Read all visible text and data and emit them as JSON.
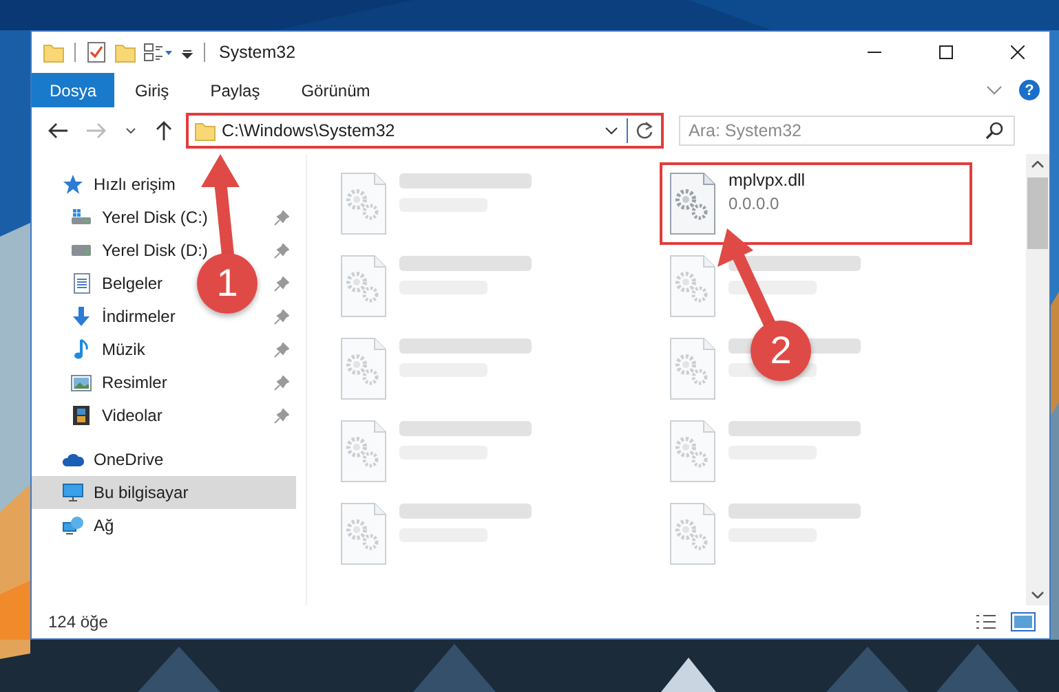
{
  "window": {
    "title": "System32"
  },
  "ribbon": {
    "tabs": [
      {
        "label": "Dosya",
        "kind": "file"
      },
      {
        "label": "Giriş",
        "kind": "tab"
      },
      {
        "label": "Paylaş",
        "kind": "tab"
      },
      {
        "label": "Görünüm",
        "kind": "tab"
      }
    ],
    "help": "?"
  },
  "address_bar": {
    "path": "C:\\Windows\\System32",
    "highlighted": true,
    "forward_disabled": true
  },
  "search": {
    "placeholder": "Ara: System32"
  },
  "nav_pane": {
    "items": [
      {
        "label": "Hızlı erişim",
        "selected": false,
        "children": [
          {
            "label": "Yerel Disk (C:)",
            "pinned": true,
            "selected": false
          },
          {
            "label": "Yerel Disk (D:)",
            "pinned": true,
            "selected": false
          },
          {
            "label": "Belgeler",
            "pinned": true,
            "selected": false
          },
          {
            "label": "İndirmeler",
            "pinned": true,
            "selected": false
          },
          {
            "label": "Müzik",
            "pinned": true,
            "selected": false
          },
          {
            "label": "Resimler",
            "pinned": true,
            "selected": false
          },
          {
            "label": "Videolar",
            "pinned": true,
            "selected": false
          }
        ]
      },
      {
        "label": "OneDrive",
        "selected": false
      },
      {
        "label": "Bu bilgisayar",
        "selected": true
      },
      {
        "label": "Ağ",
        "selected": false
      }
    ]
  },
  "files": [
    {
      "kind": "blurred"
    },
    {
      "kind": "file",
      "name": "mplvpx.dll",
      "type": "0.0.0.0",
      "highlighted": true
    },
    {
      "kind": "blurred"
    },
    {
      "kind": "blurred"
    },
    {
      "kind": "blurred"
    },
    {
      "kind": "blurred"
    },
    {
      "kind": "blurred"
    },
    {
      "kind": "blurred"
    },
    {
      "kind": "blurred"
    },
    {
      "kind": "blurred"
    }
  ],
  "status_bar": {
    "count": "124 öğe"
  },
  "annotations": [
    {
      "number": "1"
    },
    {
      "number": "2"
    }
  ]
}
